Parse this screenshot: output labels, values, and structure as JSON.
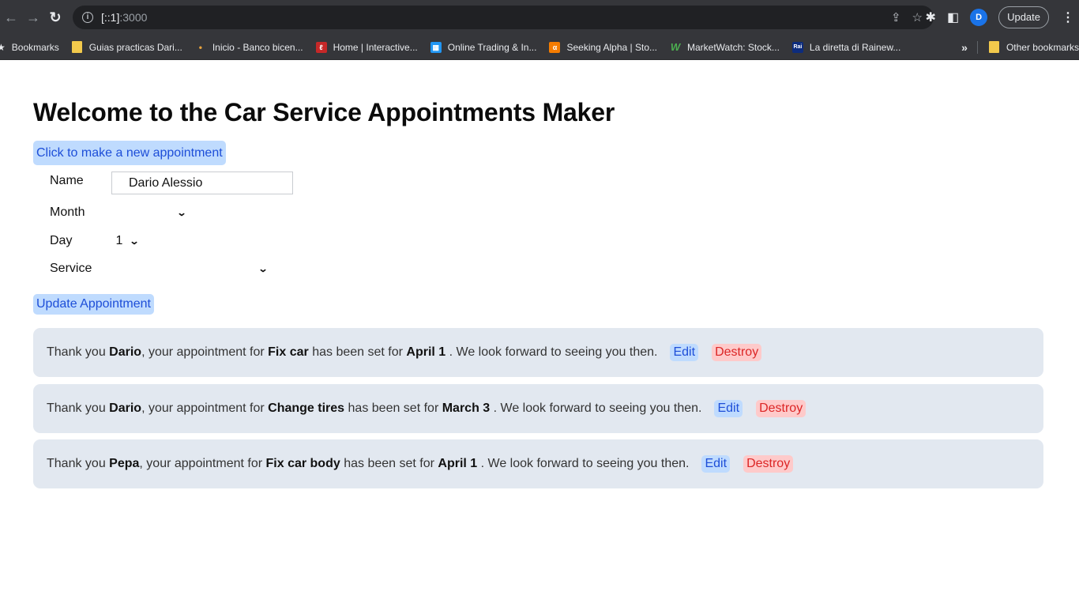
{
  "browser": {
    "url_host": "[::1]",
    "url_port": ":3000",
    "update_label": "Update",
    "avatar_letter": "D",
    "bookmarks": [
      {
        "label": "Bookmarks",
        "icon": "star-icon"
      },
      {
        "label": "Guias practicas Dari...",
        "icon": "folder-icon"
      },
      {
        "label": "Inicio - Banco bicen...",
        "icon": "bank-icon"
      },
      {
        "label": "Home | Interactive...",
        "icon": "interactive-icon"
      },
      {
        "label": "Online Trading & In...",
        "icon": "trading-icon"
      },
      {
        "label": "Seeking Alpha | Sto...",
        "icon": "alpha-icon"
      },
      {
        "label": "MarketWatch: Stock...",
        "icon": "marketwatch-icon"
      },
      {
        "label": "La diretta di Rainew...",
        "icon": "rai-icon"
      }
    ],
    "more_label": "»",
    "other_bookmarks": "Other bookmarks"
  },
  "page": {
    "title": "Welcome to the Car Service Appointments Maker",
    "new_appointment_label": "Click to make a new appointment",
    "form": {
      "name_label": "Name",
      "name_value": "Dario Alessio",
      "month_label": "Month",
      "month_value": "",
      "day_label": "Day",
      "day_value": "1",
      "service_label": "Service",
      "service_value": ""
    },
    "update_label": "Update Appointment",
    "appointments": [
      {
        "prefix": "Thank you ",
        "name": "Dario",
        "mid1": ", your appointment for ",
        "service": "Fix car",
        "mid2": " has been set for ",
        "date": "April 1",
        "suffix": " . We look forward to seeing you then.",
        "edit": "Edit",
        "destroy": "Destroy"
      },
      {
        "prefix": "Thank you ",
        "name": "Dario",
        "mid1": ", your appointment for ",
        "service": "Change tires",
        "mid2": " has been set for ",
        "date": "March 3",
        "suffix": " . We look forward to seeing you then.",
        "edit": "Edit",
        "destroy": "Destroy"
      },
      {
        "prefix": "Thank you ",
        "name": "Pepa",
        "mid1": ", your appointment for ",
        "service": "Fix car body",
        "mid2": " has been set for ",
        "date": "April 1",
        "suffix": " . We look forward to seeing you then.",
        "edit": "Edit",
        "destroy": "Destroy"
      }
    ]
  }
}
